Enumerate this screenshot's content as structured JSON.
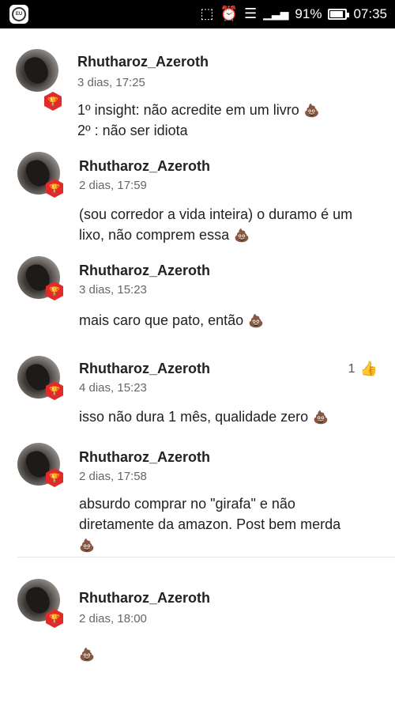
{
  "status_bar": {
    "app_icon": "eu-app-icon",
    "app_icon_text": "EU",
    "icons": [
      "nfc-icon",
      "alarm-icon",
      "wifi-icon",
      "signal-icon"
    ],
    "battery": "91%",
    "battery_level": 0.91,
    "time": "07:35"
  },
  "comments": [
    {
      "author": "Rhutharoz_Azeroth",
      "time": "3 dias, 17:25",
      "lines": [
        "1º insight: não acredite em um livro",
        "2º : não ser idiota"
      ],
      "emoji": "pile-of-poo"
    },
    {
      "author": "Rhutharoz_Azeroth",
      "time": "2 dias, 17:59",
      "lines": [
        "(sou corredor a vida inteira) o duramo é um",
        "lixo, não comprem essa"
      ],
      "emoji": "pile-of-poo"
    },
    {
      "author": "Rhutharoz_Azeroth",
      "time": "3 dias, 15:23",
      "lines": [
        "mais caro que pato, então"
      ],
      "emoji": "pile-of-poo"
    },
    {
      "author": "Rhutharoz_Azeroth",
      "time": "4 dias, 15:23",
      "lines": [
        "isso não dura 1 mês, qualidade zero"
      ],
      "emoji": "pile-of-poo",
      "likes": "1"
    },
    {
      "author": "Rhutharoz_Azeroth",
      "time": "2 dias, 17:58",
      "lines": [
        "absurdo comprar no \"girafa\" e não",
        "diretamente da amazon. Post bem merda"
      ],
      "emoji": "pile-of-poo"
    },
    {
      "author": "Rhutharoz_Azeroth",
      "time": "2 dias, 18:00",
      "lines": [],
      "emoji": "pile-of-poo"
    }
  ]
}
